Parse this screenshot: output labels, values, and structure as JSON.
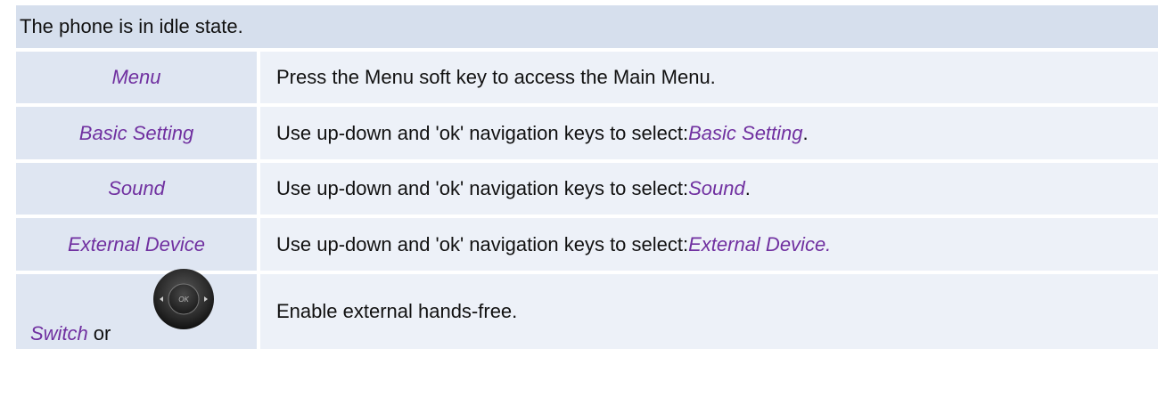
{
  "header": "The phone is in idle state.",
  "rows": [
    {
      "key": "Menu",
      "desc": "Press the Menu soft key to access the Main Menu."
    },
    {
      "key": "Basic Setting",
      "desc_prefix": "Use up-down and 'ok' navigation keys to select: ",
      "desc_em": "Basic Setting",
      "desc_suffix": "."
    },
    {
      "key": "Sound",
      "desc_prefix": "Use up-down and 'ok' navigation keys to select: ",
      "desc_em": "Sound",
      "desc_suffix": "."
    },
    {
      "key": "External Device",
      "desc_prefix": "Use up-down and 'ok' navigation keys to select: ",
      "desc_em": "External Device.",
      "desc_suffix": ""
    },
    {
      "key": "Switch",
      "or": "or",
      "navkey_label": "OK",
      "desc": "Enable external hands-free."
    }
  ],
  "colors": {
    "accent_text": "#7030a0",
    "header_bg": "#d6dfed",
    "key_bg": "#dfe6f2",
    "desc_bg": "#edf1f8"
  },
  "icons": {
    "navigation_key": "ok-navigation-key-icon"
  }
}
